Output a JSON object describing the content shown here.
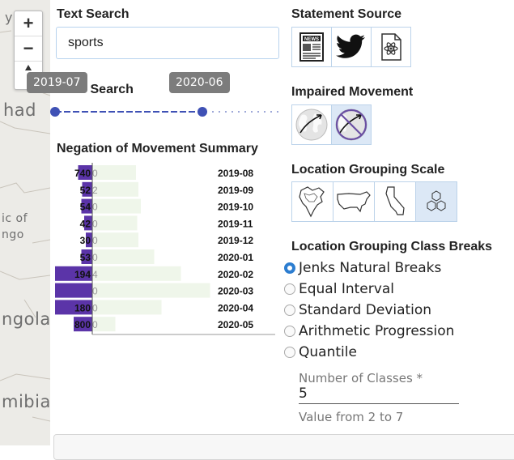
{
  "map": {
    "labels": [
      "y)",
      "had",
      "ic of",
      "ngo",
      "ngola",
      "mibia"
    ],
    "zoom_in": "+",
    "zoom_out": "−"
  },
  "text_search": {
    "heading": "Text Search",
    "value": "sports"
  },
  "time_search": {
    "heading": "Time Search",
    "start_label": "2019-07",
    "end_label": "2020-06",
    "start_fraction": 0.0,
    "end_fraction": 0.646
  },
  "negation_summary": {
    "heading": "Negation of Movement Summary"
  },
  "chart_data": {
    "type": "bar",
    "categories": [
      "2019-08",
      "2019-09",
      "2019-10",
      "2019-11",
      "2019-12",
      "2020-01",
      "2020-02",
      "2020-03",
      "2020-04",
      "2020-05"
    ],
    "series": [
      {
        "values": [
          740,
          52,
          54,
          42,
          30,
          53,
          194,
          0,
          180,
          800
        ]
      },
      {
        "values": [
          0,
          2,
          0,
          0,
          0,
          0,
          4,
          0,
          0,
          0
        ]
      }
    ],
    "left_fraction": [
      0.35,
      0.25,
      0.27,
      0.2,
      0.16,
      0.27,
      0.92,
      0.92,
      0.92,
      0.46
    ],
    "right_fraction": [
      0.36,
      0.38,
      0.4,
      0.37,
      0.38,
      0.51,
      0.73,
      0.97,
      0.57,
      0.19
    ],
    "colors": {
      "left": "#5b34a8",
      "right": "#eff6ea",
      "axis": "#555555"
    }
  },
  "statement_source": {
    "heading": "Statement Source",
    "buttons": [
      {
        "icon": "newspaper-icon",
        "active": true
      },
      {
        "icon": "twitter-bird-icon",
        "active": false
      },
      {
        "icon": "document-atom-icon",
        "active": false
      }
    ]
  },
  "impaired_movement": {
    "heading": "Impaired Movement",
    "buttons": [
      {
        "icon": "globe-arrow-icon",
        "active": false
      },
      {
        "icon": "globe-arrow-blocked-icon",
        "active": true
      }
    ]
  },
  "location_scale": {
    "heading": "Location Grouping Scale",
    "buttons": [
      {
        "icon": "north-america-icon",
        "active": false
      },
      {
        "icon": "usa-map-icon",
        "active": false
      },
      {
        "icon": "california-icon",
        "active": false
      },
      {
        "icon": "hexagon-grid-icon",
        "active": true
      }
    ]
  },
  "class_breaks": {
    "heading": "Location Grouping Class Breaks",
    "options": [
      {
        "label": "Jenks Natural Breaks",
        "checked": true
      },
      {
        "label": "Equal Interval",
        "checked": false
      },
      {
        "label": "Standard Deviation",
        "checked": false
      },
      {
        "label": "Arithmetic Progression",
        "checked": false
      },
      {
        "label": "Quantile",
        "checked": false
      }
    ]
  },
  "num_classes": {
    "label": "Number of Classes *",
    "value": "5",
    "helper": "Value from 2 to 7"
  },
  "theme": {
    "accent": "#3f51b5",
    "radio_accent": "#2c7dd0",
    "tooltip_bg": "#7c7c7c"
  }
}
